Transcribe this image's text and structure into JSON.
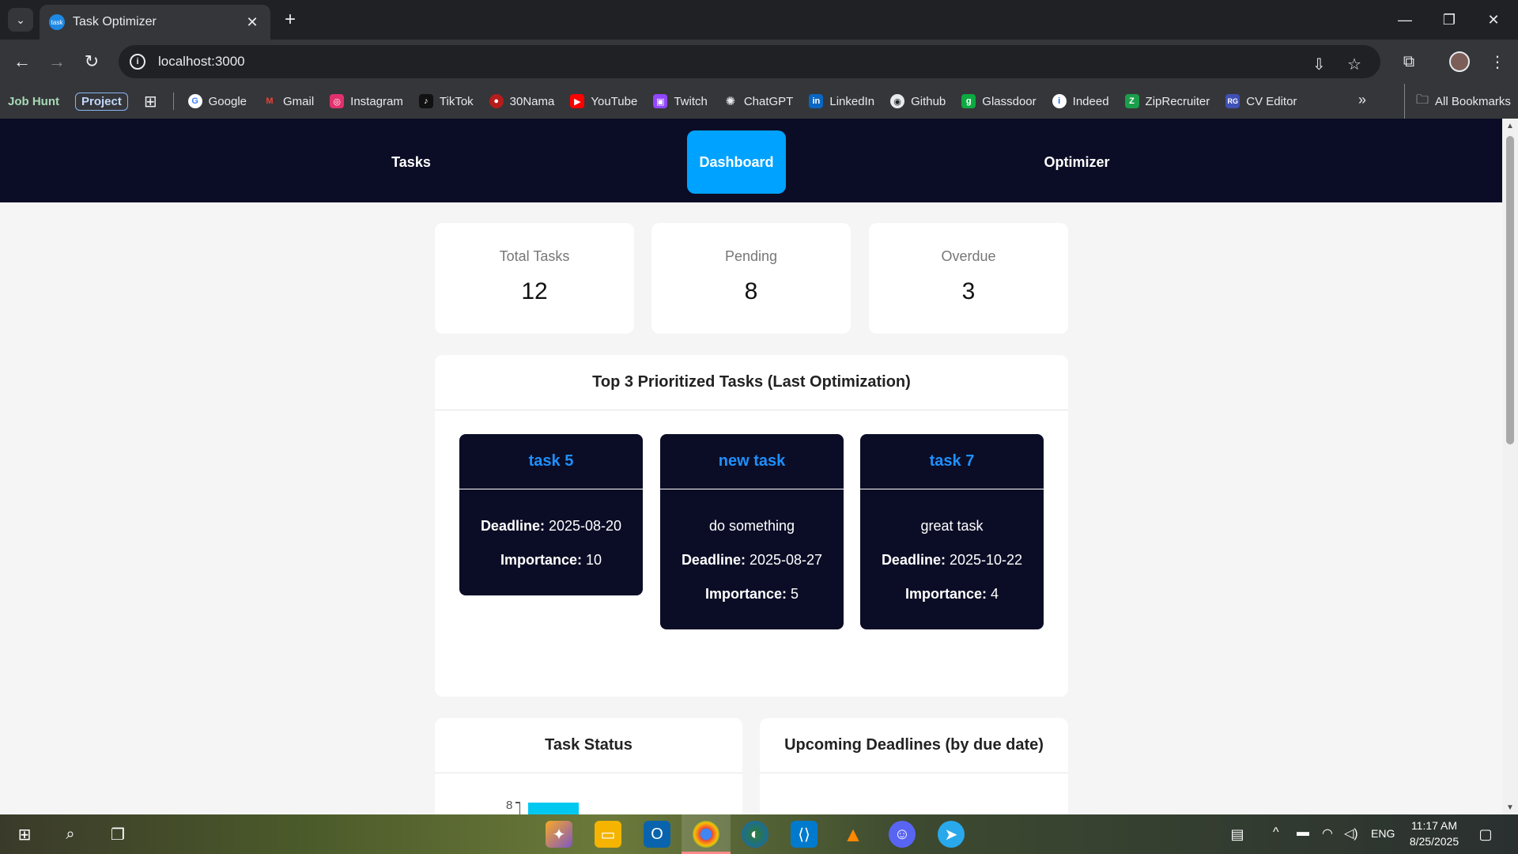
{
  "browser": {
    "tab_title": "Task Optimizer",
    "tab_favicon_text": "task",
    "url": "localhost:3000",
    "bookmarks": [
      {
        "label": "Job Hunt",
        "style": "bold"
      },
      {
        "label": "Project",
        "style": "boxed"
      },
      {
        "label": "Google",
        "icon": "google-icon",
        "color": "#4285f4"
      },
      {
        "label": "Gmail",
        "icon": "gmail-icon",
        "color": "#ea4335"
      },
      {
        "label": "Instagram",
        "icon": "instagram-icon",
        "color": "#e1306c"
      },
      {
        "label": "TikTok",
        "icon": "tiktok-icon",
        "color": "#111111"
      },
      {
        "label": "30Nama",
        "icon": "30nama-icon",
        "color": "#b71c1c"
      },
      {
        "label": "YouTube",
        "icon": "youtube-icon",
        "color": "#ff0000"
      },
      {
        "label": "Twitch",
        "icon": "twitch-icon",
        "color": "#9146ff"
      },
      {
        "label": "ChatGPT",
        "icon": "chatgpt-icon",
        "color": "#5f6368"
      },
      {
        "label": "LinkedIn",
        "icon": "linkedin-icon",
        "color": "#0a66c2"
      },
      {
        "label": "Github",
        "icon": "github-icon",
        "color": "#24292e"
      },
      {
        "label": "Glassdoor",
        "icon": "glassdoor-icon",
        "color": "#0caa41"
      },
      {
        "label": "Indeed",
        "icon": "indeed-icon",
        "color": "#2164f3"
      },
      {
        "label": "ZipRecruiter",
        "icon": "ziprecruiter-icon",
        "color": "#1a9e4a"
      },
      {
        "label": "CV Editor",
        "icon": "cv-editor-icon",
        "color": "#3f51b5"
      }
    ],
    "all_bookmarks": "All Bookmarks"
  },
  "app": {
    "nav": [
      {
        "label": "Tasks",
        "active": false
      },
      {
        "label": "Dashboard",
        "active": true
      },
      {
        "label": "Optimizer",
        "active": false
      }
    ],
    "stats": [
      {
        "label": "Total Tasks",
        "value": "12"
      },
      {
        "label": "Pending",
        "value": "8"
      },
      {
        "label": "Overdue",
        "value": "3"
      }
    ],
    "prioritized": {
      "title": "Top 3 Prioritized Tasks (Last Optimization)",
      "deadline_label": "Deadline:",
      "importance_label": "Importance:",
      "tasks": [
        {
          "name": "task 5",
          "description": "",
          "deadline": "2025-08-20",
          "importance": "10"
        },
        {
          "name": "new task",
          "description": "do something",
          "deadline": "2025-08-27",
          "importance": "5"
        },
        {
          "name": "task 7",
          "description": "great task",
          "deadline": "2025-10-22",
          "importance": "4"
        }
      ]
    },
    "task_status": {
      "title": "Task Status",
      "visible_tick": "8"
    },
    "upcoming": {
      "title": "Upcoming Deadlines (by due date)"
    }
  },
  "taskbar": {
    "language": "ENG",
    "time": "11:17 AM",
    "date": "8/25/2025"
  },
  "colors": {
    "nav_bg": "#0b0d26",
    "active_nav": "#00a2ff",
    "task_name": "#1e90ff",
    "bar": "#00c8f0"
  }
}
